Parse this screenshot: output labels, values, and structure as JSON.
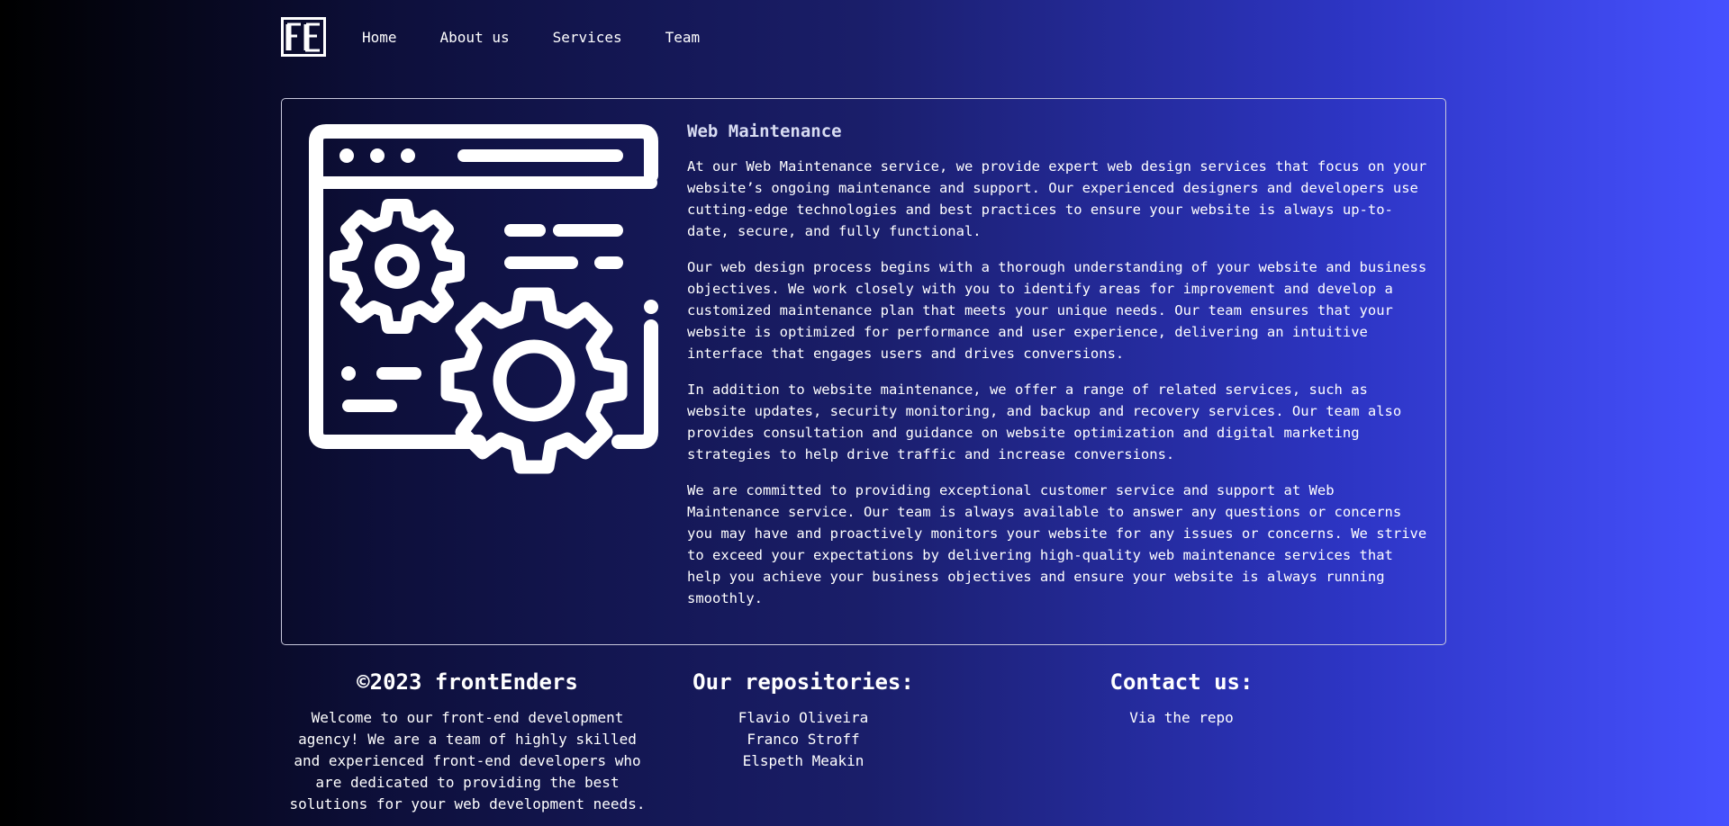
{
  "nav": {
    "logo_alt": "frontEnders logo",
    "links": [
      {
        "label": "Home"
      },
      {
        "label": "About us"
      },
      {
        "label": "Services"
      },
      {
        "label": "Team"
      }
    ]
  },
  "main": {
    "illustration_icon": "web-maintenance-gear-icon",
    "title": "Web Maintenance",
    "paragraphs": [
      "At our Web Maintenance service, we provide expert web design services that focus on your website’s ongoing maintenance and support. Our experienced designers and developers use cutting-edge technologies and best practices to ensure your website is always up-to-date, secure, and fully functional.",
      "Our web design process begins with a thorough understanding of your website and business objectives. We work closely with you to identify areas for improvement and develop a customized maintenance plan that meets your unique needs. Our team ensures that your website is optimized for performance and user experience, delivering an intuitive interface that engages users and drives conversions.",
      "In addition to website maintenance, we offer a range of related services, such as website updates, security monitoring, and backup and recovery services. Our team also provides consultation and guidance on website optimization and digital marketing strategies to help drive traffic and increase conversions.",
      "We are committed to providing exceptional customer service and support at Web Maintenance service. Our team is always available to answer any questions or concerns you may have and proactively monitors your website for any issues or concerns. We strive to exceed your expectations by delivering high-quality web maintenance services that help you achieve your business objectives and ensure your website is always running smoothly."
    ]
  },
  "footer": {
    "about": {
      "title": "©2023 frontEnders",
      "text": "Welcome to our front-end development agency! We are a team of highly skilled and experienced front-end developers who are dedicated to providing the best solutions for your web development needs."
    },
    "repos": {
      "title": "Our repositories:",
      "items": [
        "Flavio Oliveira",
        "Franco Stroff",
        "Elspeth Meakin"
      ]
    },
    "contact": {
      "title": "Contact us:",
      "link": "Via the repo"
    }
  },
  "colors": {
    "background_start": "#000000",
    "background_end": "#4651ff",
    "text": "#ffffff",
    "card_border": "#c8c8dc"
  }
}
